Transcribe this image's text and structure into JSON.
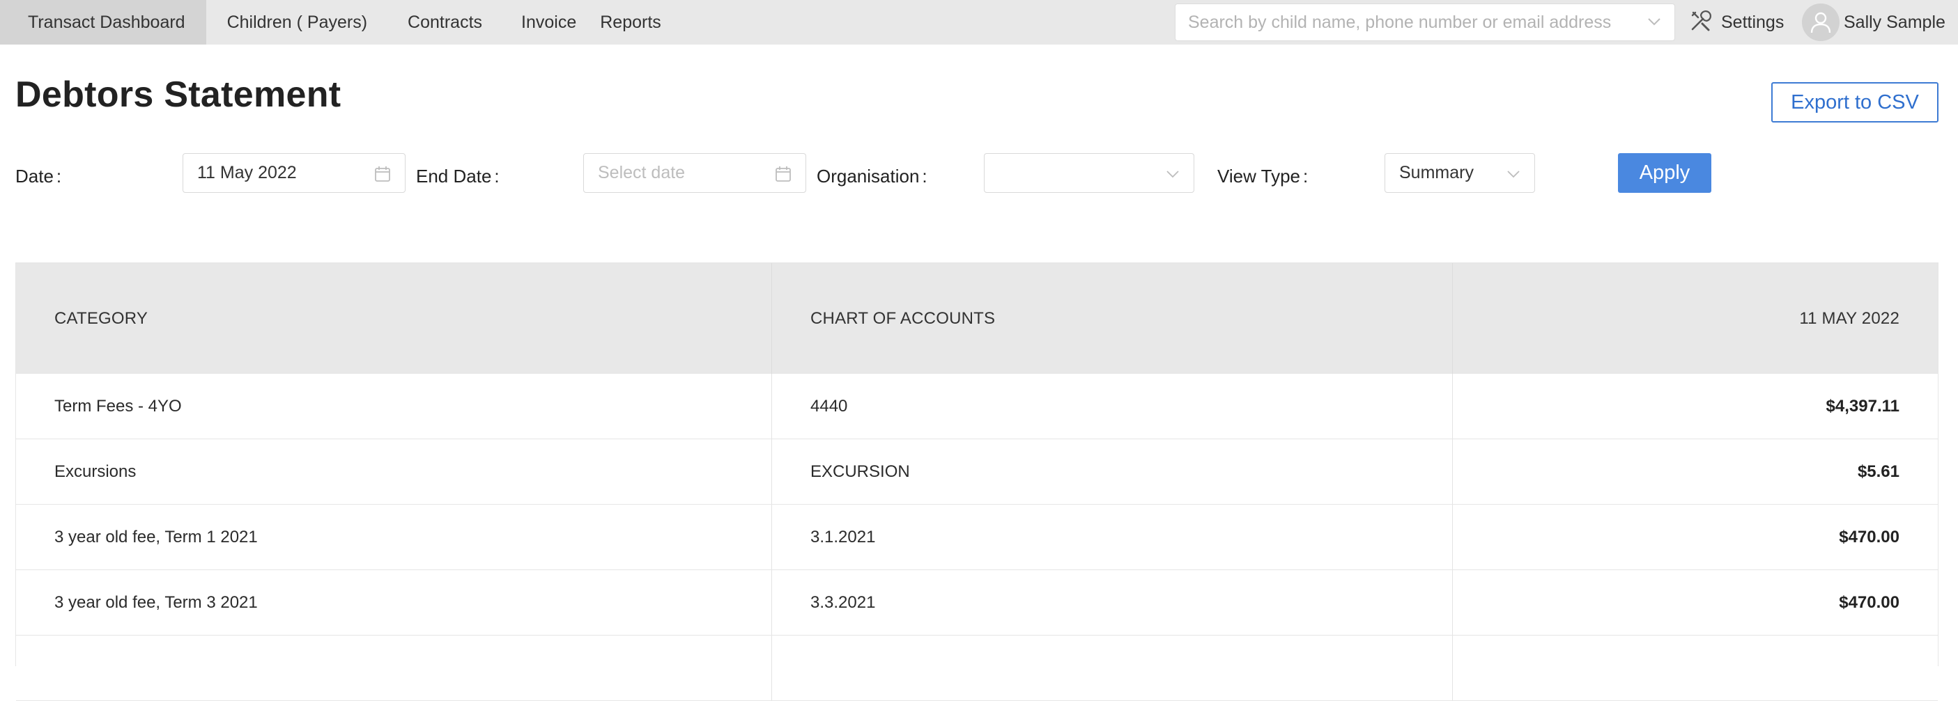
{
  "nav": {
    "tabs": [
      {
        "label": "Transact Dashboard"
      },
      {
        "label": "Children ( Payers)"
      },
      {
        "label": "Contracts"
      },
      {
        "label": "Invoice"
      },
      {
        "label": "Reports"
      }
    ],
    "search": {
      "placeholder": "Search by child name, phone number or email address",
      "value": ""
    },
    "settings_label": "Settings",
    "user_name": "Sally Sample"
  },
  "page": {
    "title": "Debtors Statement",
    "export_label": "Export to CSV"
  },
  "filters": {
    "date": {
      "label": "Date",
      "value": "11 May 2022"
    },
    "end_date": {
      "label": "End Date",
      "placeholder": "Select date"
    },
    "organisation": {
      "label": "Organisation",
      "value": ""
    },
    "view_type": {
      "label": "View Type",
      "value": "Summary"
    },
    "apply_label": "Apply"
  },
  "table": {
    "headers": [
      "CATEGORY",
      "CHART OF ACCOUNTS",
      "11 MAY 2022"
    ],
    "rows": [
      {
        "category": "Term Fees - 4YO",
        "account": "4440",
        "amount": "$4,397.11"
      },
      {
        "category": "Excursions",
        "account": "EXCURSION",
        "amount": "$5.61"
      },
      {
        "category": "3 year old fee, Term 1 2021",
        "account": "3.1.2021",
        "amount": "$470.00"
      },
      {
        "category": "3 year old fee, Term 3 2021",
        "account": "3.3.2021",
        "amount": "$470.00"
      },
      {
        "category": "",
        "account": "",
        "amount": ""
      }
    ]
  },
  "colors": {
    "accent": "#4a88e0",
    "nav_bg": "#e8e8e8",
    "nav_active_bg": "#d4d4d4",
    "table_header_bg": "#e8e8e8"
  },
  "icons": {
    "search_dropdown": "chevron-down-icon",
    "settings": "tools-icon",
    "user": "user-icon",
    "date": "calendar-icon",
    "select": "chevron-down-icon"
  }
}
